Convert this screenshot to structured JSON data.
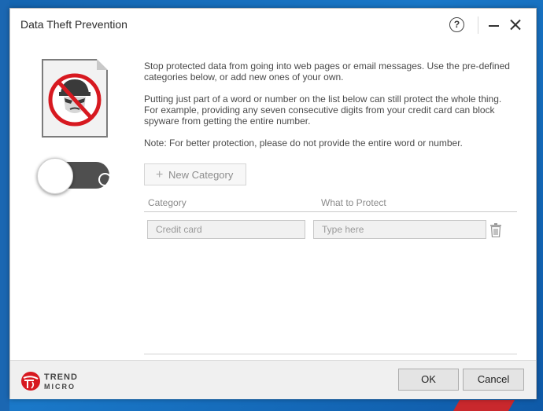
{
  "window": {
    "title": "Data Theft Prevention",
    "help_glyph": "?"
  },
  "description": {
    "para1": "Stop protected data from going into web pages or email messages. Use the pre-defined categories below, or add new ones of your own.",
    "para2": "Putting just part of a word or number on the list below can still protect the whole thing. For example, providing any seven consecutive digits from your credit card can block spyware from getting the entire number.",
    "para3": "Note: For better protection, please do not provide the entire word or number."
  },
  "toggle": {
    "state": "off"
  },
  "new_category": {
    "plus": "+",
    "label": "New Category"
  },
  "table": {
    "headers": {
      "category": "Category",
      "what_to_protect": "What to Protect"
    },
    "rows": [
      {
        "category": "Credit card",
        "what_placeholder": "Type here"
      }
    ]
  },
  "footer": {
    "logo_line1": "TREND",
    "logo_line2": "MICRO",
    "ok_label": "OK",
    "cancel_label": "Cancel"
  },
  "colors": {
    "brand_red": "#d71920",
    "toggle_track": "#4f4f4f"
  },
  "icons": {
    "main": "spy-prohibited-icon",
    "trash": "trash-icon"
  }
}
